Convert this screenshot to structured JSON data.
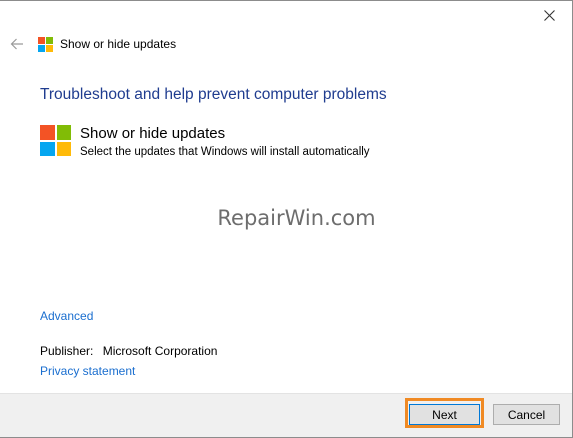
{
  "window": {
    "title": "Show or hide updates",
    "close_icon": "close-icon",
    "back_icon": "back-arrow-icon"
  },
  "main": {
    "heading": "Troubleshoot and help prevent computer problems",
    "item": {
      "title": "Show or hide updates",
      "description": "Select the updates that Windows will install automatically",
      "icon": "windows-logo-icon"
    },
    "watermark": "RepairWin.com",
    "advanced_link": "Advanced",
    "publisher_label": "Publisher:",
    "publisher_value": "Microsoft Corporation",
    "privacy_link": "Privacy statement"
  },
  "footer": {
    "next_label": "Next",
    "cancel_label": "Cancel"
  },
  "colors": {
    "heading": "#1f3c8f",
    "link": "#1a6ecf",
    "highlight": "#f08a24",
    "logo_red": "#f35325",
    "logo_green": "#81bc06",
    "logo_blue": "#05a6f0",
    "logo_yellow": "#ffba08"
  }
}
